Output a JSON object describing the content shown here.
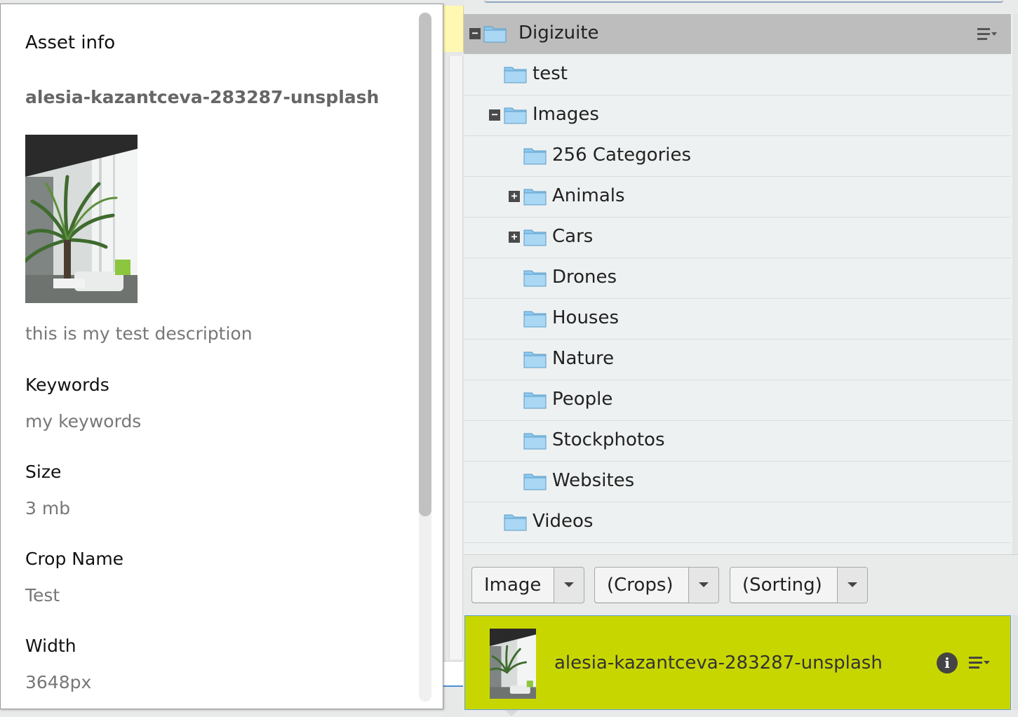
{
  "info_panel": {
    "title": "Asset info",
    "asset_name": "alesia-kazantceva-283287-unsplash",
    "description": "this is my test description",
    "fields": [
      {
        "label": "Keywords",
        "value": "my keywords"
      },
      {
        "label": "Size",
        "value": "3 mb"
      },
      {
        "label": "Crop Name",
        "value": "Test"
      },
      {
        "label": "Width",
        "value": "3648px"
      }
    ]
  },
  "tree": {
    "root": {
      "label": "Digizuite",
      "expanded": true
    },
    "items": [
      {
        "label": "test",
        "level": 1,
        "toggle": ""
      },
      {
        "label": "Images",
        "level": 1,
        "toggle": "−"
      },
      {
        "label": "256 Categories",
        "level": 2,
        "toggle": ""
      },
      {
        "label": "Animals",
        "level": 2,
        "toggle": "+"
      },
      {
        "label": "Cars",
        "level": 2,
        "toggle": "+"
      },
      {
        "label": "Drones",
        "level": 2,
        "toggle": ""
      },
      {
        "label": "Houses",
        "level": 2,
        "toggle": ""
      },
      {
        "label": "Nature",
        "level": 2,
        "toggle": ""
      },
      {
        "label": "People",
        "level": 2,
        "toggle": ""
      },
      {
        "label": "Stockphotos",
        "level": 2,
        "toggle": ""
      },
      {
        "label": "Websites",
        "level": 2,
        "toggle": ""
      },
      {
        "label": "Videos",
        "level": 1,
        "toggle": ""
      }
    ]
  },
  "filters": {
    "type": "Image",
    "crops": "(Crops)",
    "sorting": "(Sorting)"
  },
  "selected_asset": {
    "name": "alesia-kazantceva-283287-unsplash",
    "info_icon": "i"
  },
  "colors": {
    "selected_row": "#c8d600",
    "tree_root": "#bdbdbd",
    "folder": "#8ec8ee"
  }
}
